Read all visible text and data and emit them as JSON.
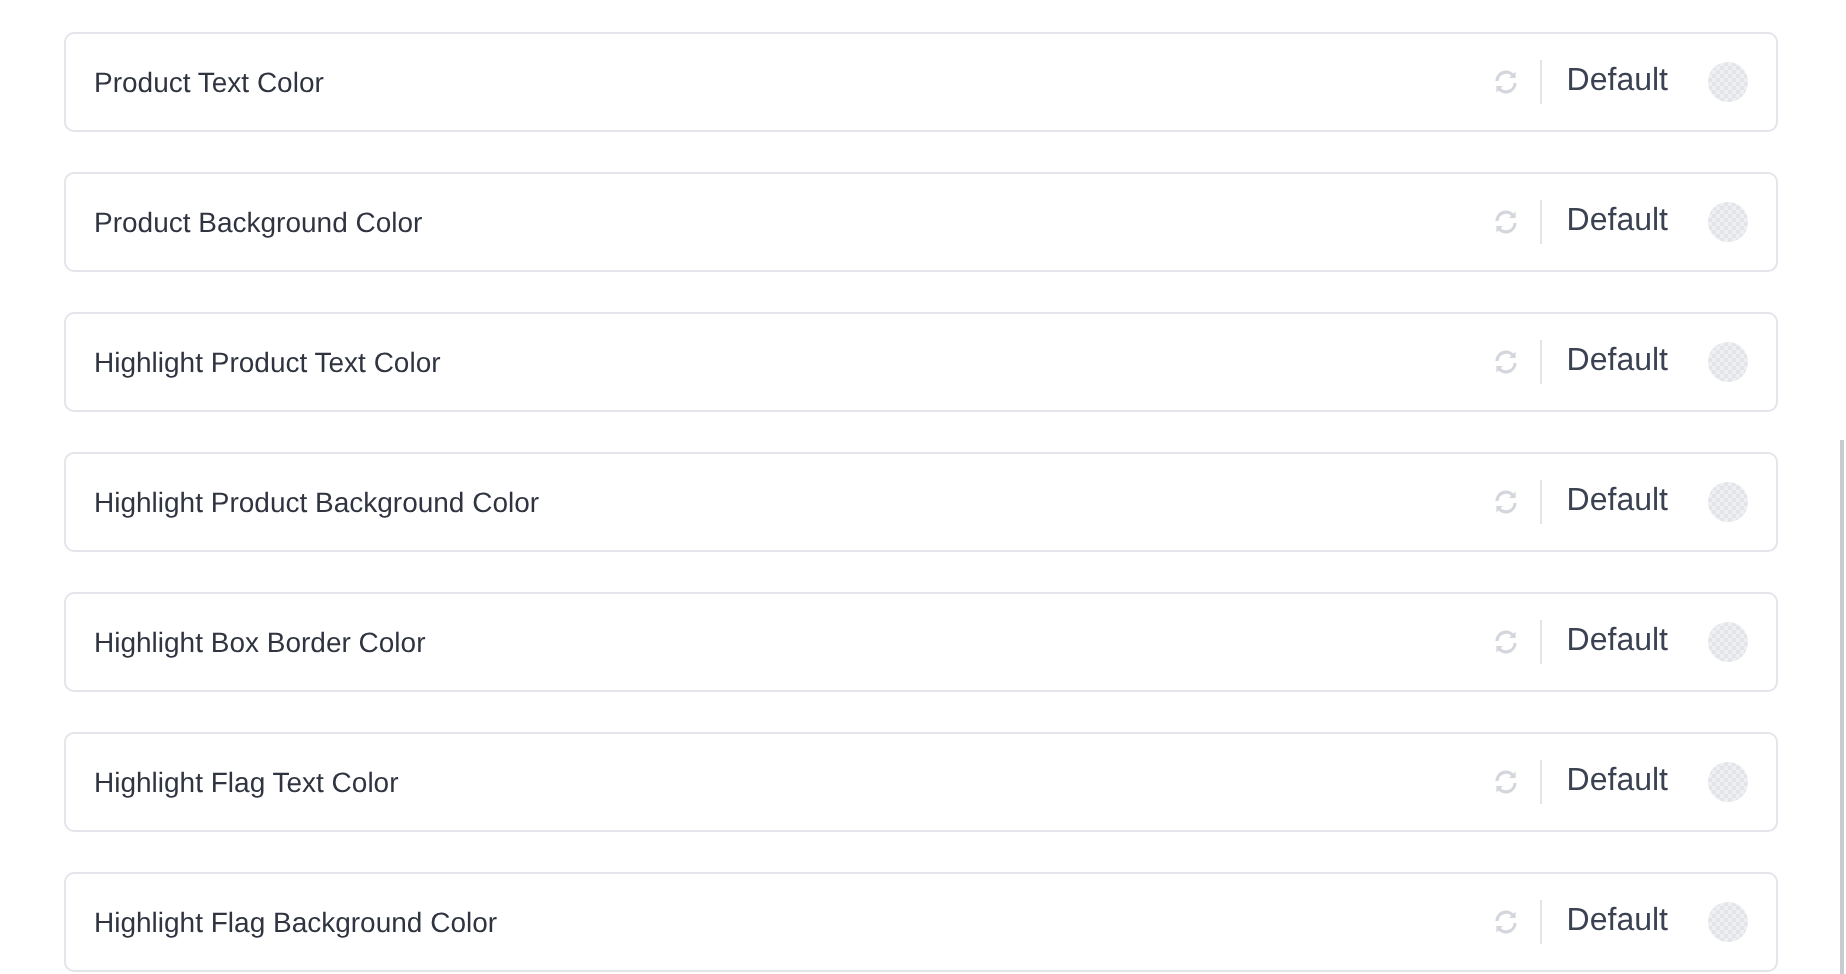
{
  "settings": [
    {
      "label": "Product Text Color",
      "value": "Default"
    },
    {
      "label": "Product Background Color",
      "value": "Default"
    },
    {
      "label": "Highlight Product Text Color",
      "value": "Default"
    },
    {
      "label": "Highlight Product Background Color",
      "value": "Default"
    },
    {
      "label": "Highlight Box Border Color",
      "value": "Default"
    },
    {
      "label": "Highlight Flag Text Color",
      "value": "Default"
    },
    {
      "label": "Highlight Flag Background Color",
      "value": "Default"
    }
  ]
}
